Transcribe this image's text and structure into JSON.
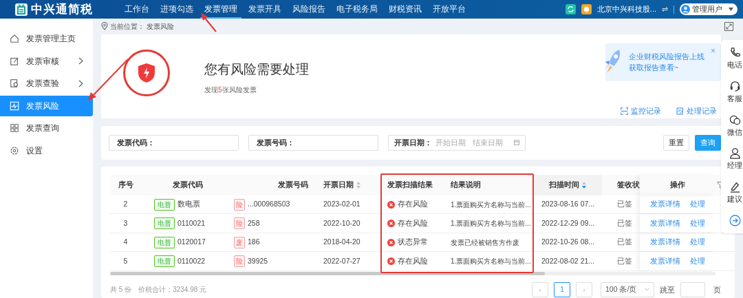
{
  "topbar": {
    "logo": "中兴通简税",
    "nav": [
      {
        "label": "工作台",
        "selected": false
      },
      {
        "label": "进项勾选",
        "selected": false
      },
      {
        "label": "发票管理",
        "selected": true
      },
      {
        "label": "发票开具",
        "selected": false
      },
      {
        "label": "风险报告",
        "selected": false
      },
      {
        "label": "电子税务局",
        "selected": false
      },
      {
        "label": "财税资讯",
        "selected": false
      },
      {
        "label": "开放平台",
        "selected": false
      }
    ],
    "company": "北京中兴科技股...",
    "switch": "⇌",
    "user": "管理用户"
  },
  "sidebar": {
    "items": [
      {
        "label": "发票管理主页",
        "expandable": false,
        "selected": false
      },
      {
        "label": "发票审核",
        "expandable": true,
        "selected": false
      },
      {
        "label": "发票查验",
        "expandable": true,
        "selected": false
      },
      {
        "label": "发票风险",
        "expandable": false,
        "selected": true
      },
      {
        "label": "发票查询",
        "expandable": false,
        "selected": false
      },
      {
        "label": "设置",
        "expandable": false,
        "selected": false
      }
    ]
  },
  "breadcrumb": {
    "label": "当前位置：",
    "value": "发票风险"
  },
  "risk": {
    "title": "您有风险需要处理",
    "prefix": "发现",
    "count": "5",
    "suffix": "张风险发票",
    "promo": [
      "企业财税风险报告上线",
      "获取报告查看~"
    ],
    "promo_close": "×",
    "links": [
      "监控记录",
      "处理记录"
    ]
  },
  "filters": {
    "fields": [
      {
        "label": "发票代码："
      },
      {
        "label": "发票号码："
      }
    ],
    "date": {
      "label": "开票日期：",
      "start": "开始日期",
      "end": "结束日期"
    },
    "buttons": [
      {
        "label": "重置",
        "primary": false
      },
      {
        "label": "查询",
        "primary": true
      }
    ]
  },
  "table": {
    "columns": [
      {
        "label": "序号",
        "sortable": false
      },
      {
        "label": "发票代码",
        "sortable": false
      },
      {
        "label": "发票号码",
        "sortable": false
      },
      {
        "label": "开票日期",
        "sortable": true,
        "sorted_desc": false
      },
      {
        "label": "发票扫描结果",
        "sortable": false
      },
      {
        "label": "结果说明",
        "sortable": false
      },
      {
        "label": "扫描时间",
        "sortable": true,
        "sorted_desc": true
      },
      {
        "label": "签收状",
        "sortable": false
      },
      {
        "label": "操作",
        "sortable": false
      }
    ],
    "rows": [
      {
        "index": "2",
        "type_tag": "电普",
        "code": "数电票",
        "status_tag": "险",
        "number": "...000968503",
        "date": "2023-02-01",
        "result": "存在风险",
        "note": "1.票面购买方名称与当前...",
        "scan_time": "2023-08-16 07...",
        "sign": "已签",
        "actions": [
          "发票详情",
          "处理"
        ]
      },
      {
        "index": "3",
        "type_tag": "电普",
        "code": "0110021",
        "status_tag": "险",
        "number": "258",
        "date": "2022-10-20",
        "result": "存在风险",
        "note": "1.票面购买方名称与当前...",
        "scan_time": "2022-12-29 09...",
        "sign": "已签",
        "actions": [
          "发票详情",
          "处理"
        ]
      },
      {
        "index": "4",
        "type_tag": "电普",
        "code": "0120017",
        "status_tag": "废",
        "number": "186",
        "date": "2018-04-20",
        "result": "状态异常",
        "note": "发票已经被销售方作废",
        "scan_time": "2022-10-26 08...",
        "sign": "已签",
        "actions": [
          "发票详情",
          "处理"
        ]
      },
      {
        "index": "5",
        "type_tag": "电普",
        "code": "0110022",
        "status_tag": "险",
        "number": "39925",
        "date": "2022-07-27",
        "result": "存在风险",
        "note": "1.票面购买方名称与当前...",
        "scan_time": "2022-08-02 21...",
        "sign": "已签",
        "actions": [
          "发票详情",
          "处理"
        ]
      }
    ],
    "summary": [
      "共 5 份",
      "价税合计：3234.98 元"
    ],
    "pagination": {
      "prev": "‹",
      "current": "1",
      "next": "›",
      "page_size": "100 条/页",
      "jump_label": "跳至",
      "page_unit": "页"
    }
  },
  "side_panel": [
    "电话",
    "客服",
    "微信",
    "经理",
    "建议"
  ]
}
